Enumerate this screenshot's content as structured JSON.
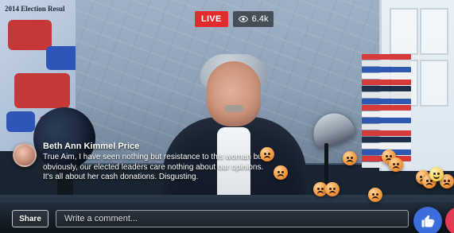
{
  "overlay": {
    "live_label": "LIVE",
    "viewer_count": "6.4k"
  },
  "background": {
    "election_map_title": "2014 Election Resul"
  },
  "comment": {
    "author": "Beth Ann Kimmel Price",
    "text": "True Aim, I have seen nothing but resistance to this woman but obviously, our elected leaders care nothing about our opinions. It's all about her cash donations. Disgusting."
  },
  "bottom_bar": {
    "share_label": "Share",
    "comment_placeholder": "Write a comment..."
  },
  "icons": {
    "eye": "eye-icon",
    "like": "thumbs-up-icon",
    "love": "heart-icon",
    "angry": "angry-emoji-icon",
    "sad": "sad-emoji-icon"
  },
  "colors": {
    "live_red": "#e32b2b",
    "like_blue": "#3b6edc",
    "love_red": "#e23c54"
  }
}
